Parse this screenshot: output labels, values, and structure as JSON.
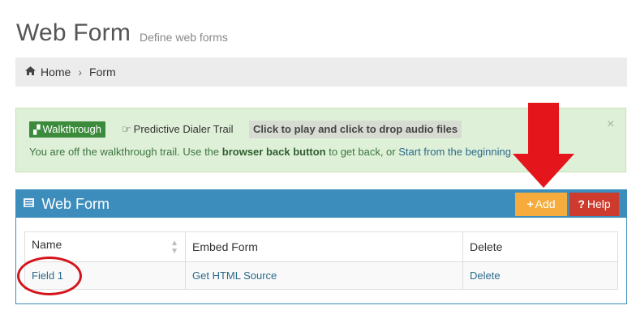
{
  "header": {
    "title": "Web Form",
    "subtitle": "Define web forms"
  },
  "breadcrumb": {
    "home_label": "Home",
    "current_label": "Form"
  },
  "alert": {
    "walkthrough_label": "Walkthrough",
    "trail_label": "Predictive Dialer Trail",
    "drop_label": "Click to play and click to drop audio files",
    "message_prefix": "You are off the walkthrough trail. Use the ",
    "message_bold": "browser back button",
    "message_middle": " to get back, or ",
    "message_link": "Start from the beginning",
    "close_symbol": "×"
  },
  "panel": {
    "title": "Web Form",
    "add_label": "Add",
    "help_label": "Help"
  },
  "table": {
    "headers": [
      "Name",
      "Embed Form",
      "Delete"
    ],
    "rows": [
      [
        "Field 1",
        "Get HTML Source",
        "Delete"
      ]
    ]
  },
  "icons": {
    "home": "home-icon",
    "chevron": "chevron-right-icon",
    "walkthrough": "road-icon",
    "trail": "hand-pointer-icon",
    "form": "list-icon",
    "add": "plus-icon",
    "help": "question-icon",
    "sort": "sort-icon"
  },
  "colors": {
    "primary": "#3c8dbc",
    "add_button": "#f5ac3c",
    "help_button": "#cc3b2e",
    "alert_bg": "#dff0d8",
    "annotation": "#e5161b"
  }
}
